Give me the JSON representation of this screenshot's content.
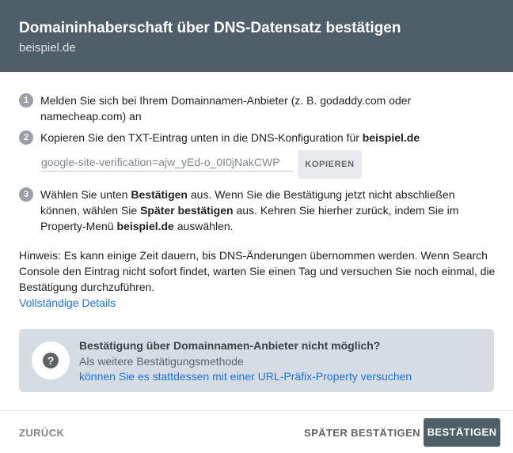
{
  "header": {
    "title": "Domaininhaberschaft über DNS-Datensatz bestätigen",
    "subtitle": "beispiel.de"
  },
  "steps": [
    {
      "number": "1",
      "line1": "Melden Sie sich bei Ihrem Domainnamen-Anbieter (z. B. godaddy.com oder",
      "line2": "namecheap.com) an"
    },
    {
      "number": "2",
      "text": "Kopieren Sie den TXT-Eintrag unten in die DNS-Konfiguration für ",
      "bold": "beispiel.de"
    },
    {
      "number": "3",
      "l1_a": "Wählen Sie unten ",
      "l1_b": "Bestätigen",
      "l1_c": " aus. Wenn Sie die Bestätigung jetzt nicht abschließen",
      "l2_a": "können, wählen Sie ",
      "l2_b": "Später bestätigen",
      "l2_c": " aus. Kehren Sie hierher zurück, indem Sie im",
      "l3_a": "Property-Menü ",
      "l3_b": "beispiel.de",
      "l3_c": " auswählen."
    }
  ],
  "txt_record": {
    "value": "google-site-verification=ajw_yEd-o_0I0jNakCWP",
    "copy_label": "KOPIEREN"
  },
  "hint": {
    "line1": "Hinweis: Es kann einige Zeit dauern, bis DNS-Änderungen übernommen werden. Wenn Search",
    "line2": "Console den Eintrag nicht sofort findet, warten Sie einen Tag und versuchen Sie noch einmal, die",
    "line3": "Bestätigung durchzuführen.",
    "link": "Vollständige Details"
  },
  "info_box": {
    "icon": "question-icon",
    "title": "Bestätigung über Domainnamen-Anbieter nicht möglich?",
    "subtitle": "Als weitere Bestätigungsmethode",
    "link": "können Sie es stattdessen mit einer URL-Präfix-Property versuchen"
  },
  "footer": {
    "back_label": "ZURÜCK",
    "later_label": "SPÄTER BESTÄTIGEN",
    "confirm_label": "BESTÄTIGEN"
  },
  "colors": {
    "header_bg": "#4f5f6a",
    "link": "#1a73e8",
    "info_bg": "#d6dde2"
  }
}
